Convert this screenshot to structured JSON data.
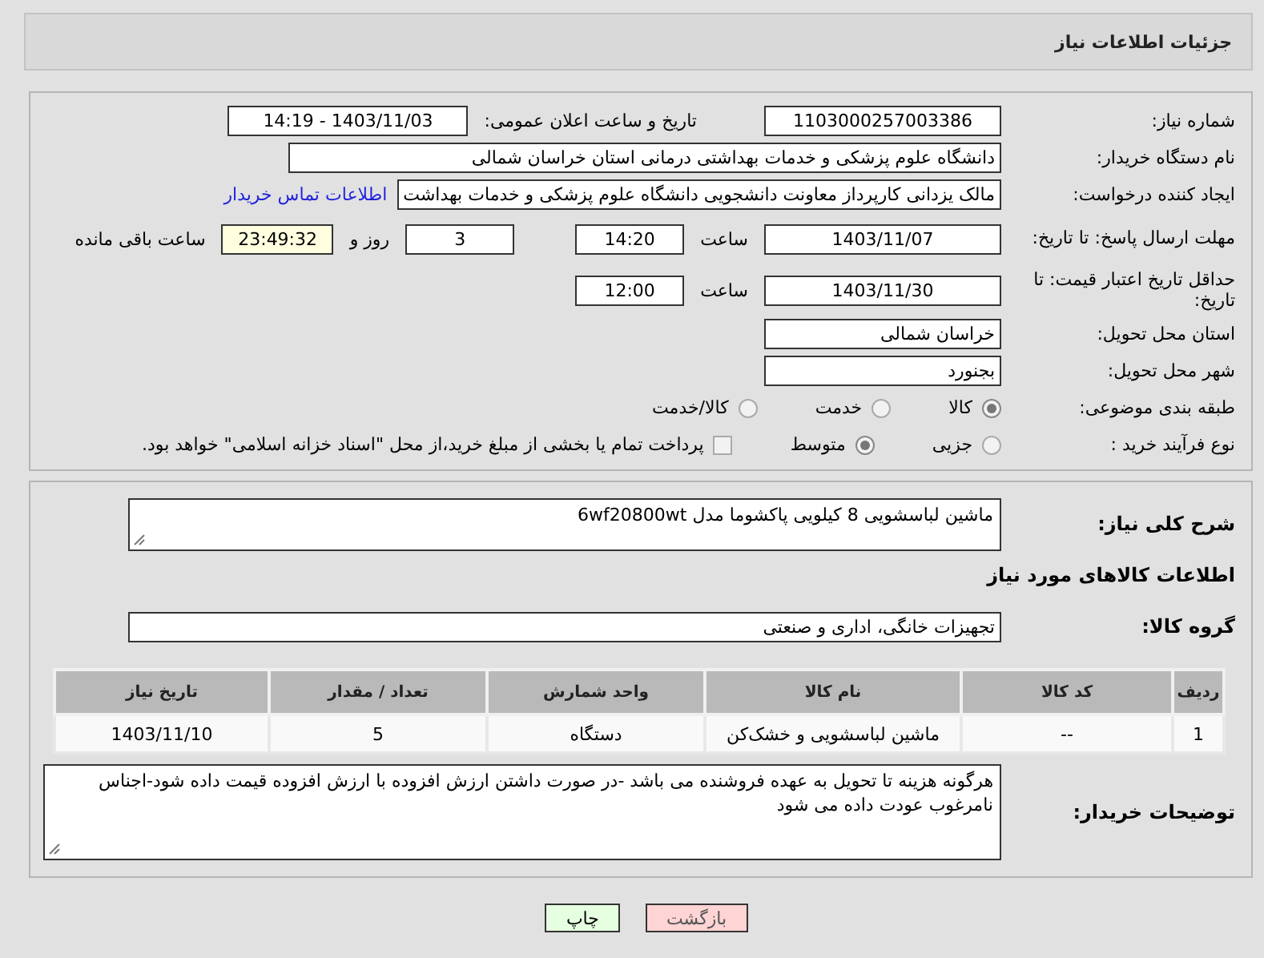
{
  "title": "جزئیات اطلاعات نیاز",
  "need_number": {
    "label": "شماره نیاز:",
    "value": "1103000257003386"
  },
  "announce": {
    "label": "تاریخ و ساعت اعلان عمومی:",
    "value": "1403/11/03 - 14:19"
  },
  "buyer_org": {
    "label": "نام دستگاه خریدار:",
    "value": "دانشگاه علوم پزشکی و خدمات بهداشتی درمانی استان خراسان شمالی"
  },
  "requester": {
    "label": "ایجاد کننده درخواست:",
    "value": "مالک یزدانی کارپرداز معاونت دانشجویی دانشگاه علوم پزشکی و خدمات بهداشت",
    "link": "اطلاعات تماس خریدار"
  },
  "reply_deadline": {
    "label": "مهلت ارسال پاسخ: تا تاریخ:",
    "date": "1403/11/07",
    "time_label": "ساعت",
    "time": "14:20",
    "days": "3",
    "days_label": "روز و",
    "remaining": "23:49:32",
    "remaining_label": "ساعت باقی مانده"
  },
  "price_validity": {
    "label": "حداقل تاریخ اعتبار قیمت: تا تاریخ:",
    "date": "1403/11/30",
    "time_label": "ساعت",
    "time": "12:00"
  },
  "province": {
    "label": "استان محل تحویل:",
    "value": "خراسان شمالی"
  },
  "city": {
    "label": "شهر محل تحویل:",
    "value": "بجنورد"
  },
  "category": {
    "label": "طبقه بندی موضوعی:",
    "options": [
      {
        "label": "کالا",
        "selected": true
      },
      {
        "label": "خدمت",
        "selected": false
      },
      {
        "label": "کالا/خدمت",
        "selected": false
      }
    ]
  },
  "purchase_type": {
    "label": "نوع فرآیند خرید :",
    "options": [
      {
        "label": "جزیی",
        "selected": false
      },
      {
        "label": "متوسط",
        "selected": true
      }
    ],
    "treasury": {
      "checked": false,
      "label": "پرداخت تمام یا بخشی از مبلغ خرید،از محل \"اسناد خزانه اسلامی\" خواهد بود."
    }
  },
  "description": {
    "label": "شرح کلی نیاز:",
    "value": "ماشین لباسشویی 8 کیلویی پاکشوما مدل 6wf20800wt"
  },
  "goods_heading": "اطلاعات کالاهای مورد نیاز",
  "goods_group": {
    "label": "گروه کالا:",
    "value": "تجهیزات خانگی، اداری و صنعتی"
  },
  "table": {
    "columns": [
      "ردیف",
      "کد کالا",
      "نام کالا",
      "واحد شمارش",
      "تعداد / مقدار",
      "تاریخ نیاز"
    ],
    "rows": [
      [
        "1",
        "--",
        "ماشین لباسشویی و خشک‌کن",
        "دستگاه",
        "5",
        "1403/11/10"
      ]
    ]
  },
  "buyer_notes": {
    "label": "توضیحات خریدار:",
    "value": "هرگونه هزینه تا تحویل به عهده فروشنده می باشد -در صورت داشتن ارزش افزوده با ارزش افزوده قیمت داده شود-اجناس نامرغوب عودت داده می شود"
  },
  "buttons": [
    {
      "label": "بازگشت",
      "kind": "back"
    },
    {
      "label": "چاپ",
      "kind": "print"
    }
  ]
}
